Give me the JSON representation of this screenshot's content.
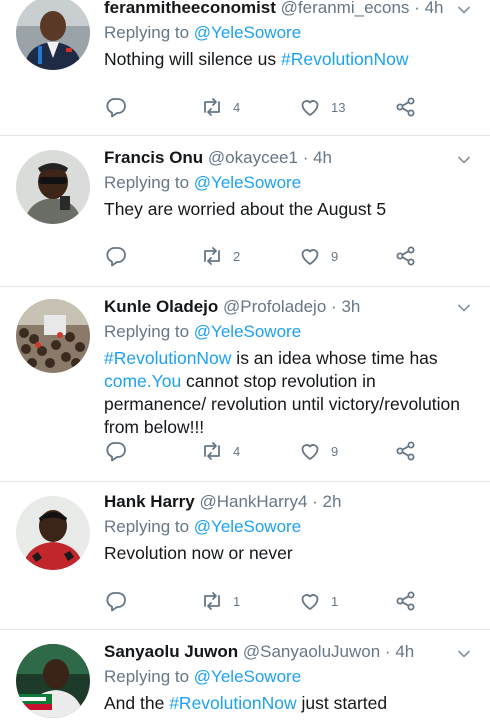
{
  "tweets": [
    {
      "name": "feranmitheeconomist",
      "handle": "@feranmi_econs",
      "separator": "·",
      "time": "4h",
      "replying_prefix": "Replying to",
      "replying_to": "@YeleSowore",
      "text_parts": [
        {
          "text": "Nothing will silence us ",
          "link": false
        },
        {
          "text": "#RevolutionNow",
          "link": true
        }
      ],
      "counts": {
        "reply": "",
        "retweet": "4",
        "like": "13"
      },
      "avatar_icon": "man-in-suit-avatar"
    },
    {
      "name": "Francis Onu",
      "handle": "@okaycee1",
      "separator": "·",
      "time": "4h",
      "replying_prefix": "Replying to",
      "replying_to": "@YeleSowore",
      "text_parts": [
        {
          "text": "They are worried about the August 5",
          "link": false
        }
      ],
      "counts": {
        "reply": "",
        "retweet": "2",
        "like": "9"
      },
      "avatar_icon": "man-with-sunglasses-avatar"
    },
    {
      "name": "Kunle Oladejo",
      "handle": "@Profoladejo",
      "separator": "·",
      "time": "3h",
      "replying_prefix": "Replying to",
      "replying_to": "@YeleSowore",
      "text_parts": [
        {
          "text": "#RevolutionNow",
          "link": true
        },
        {
          "text": " is an idea whose time has ",
          "link": false
        },
        {
          "text": "come.You",
          "link": true
        },
        {
          "text": " cannot stop revolution in permanence/ revolution until victory/revolution from below!!!",
          "link": false
        }
      ],
      "counts": {
        "reply": "",
        "retweet": "4",
        "like": "9"
      },
      "avatar_icon": "crowd-avatar"
    },
    {
      "name": "Hank Harry",
      "handle": "@HankHarry4",
      "separator": "·",
      "time": "2h",
      "replying_prefix": "Replying to",
      "replying_to": "@YeleSowore",
      "text_parts": [
        {
          "text": "Revolution now or never",
          "link": false
        }
      ],
      "counts": {
        "reply": "",
        "retweet": "1",
        "like": "1"
      },
      "avatar_icon": "man-in-red-shirt-avatar"
    },
    {
      "name": "Sanyaolu Juwon",
      "handle": "@SanyaoluJuwon",
      "separator": "·",
      "time": "4h",
      "replying_prefix": "Replying to",
      "replying_to": "@YeleSowore",
      "text_parts": [
        {
          "text": "And the ",
          "link": false
        },
        {
          "text": "#RevolutionNow",
          "link": true
        },
        {
          "text": " just started",
          "link": false
        }
      ],
      "counts": {
        "reply": "",
        "retweet": "",
        "like": ""
      },
      "avatar_icon": "man-on-tv-avatar"
    }
  ],
  "colors": {
    "accent": "#1da1f2",
    "secondary_text": "#657786",
    "divider": "#e1e8ed",
    "icon": "#657786"
  }
}
